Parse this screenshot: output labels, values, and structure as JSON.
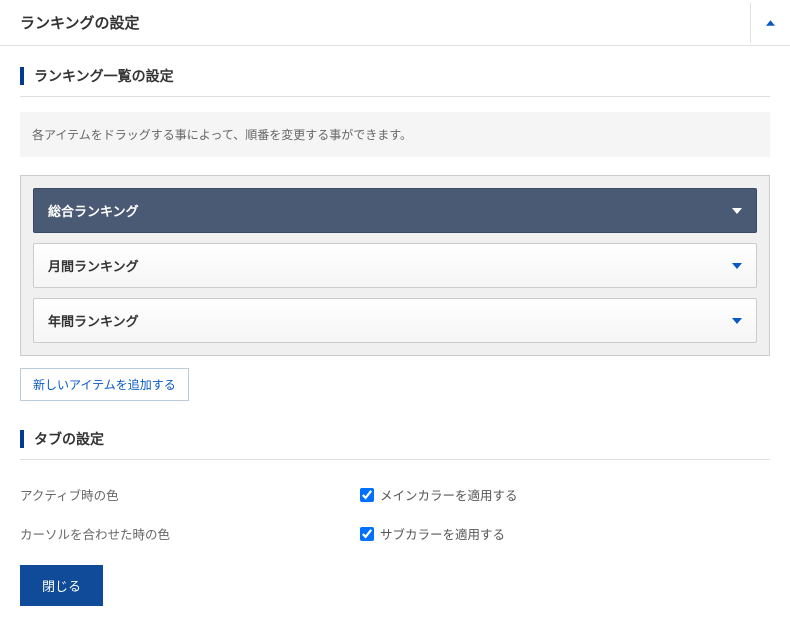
{
  "header": {
    "title": "ランキングの設定"
  },
  "section_list": {
    "title": "ランキング一覧の設定",
    "hint": "各アイテムをドラッグする事によって、順番を変更する事ができます。",
    "items": [
      {
        "label": "総合ランキング",
        "active": true
      },
      {
        "label": "月間ランキング",
        "active": false
      },
      {
        "label": "年間ランキング",
        "active": false
      }
    ],
    "add_label": "新しいアイテムを追加する"
  },
  "section_tabs": {
    "title": "タブの設定",
    "rows": [
      {
        "label": "アクティブ時の色",
        "checkbox_label": "メインカラーを適用する",
        "checked": true
      },
      {
        "label": "カーソルを合わせた時の色",
        "checkbox_label": "サブカラーを適用する",
        "checked": true
      }
    ]
  },
  "close_label": "閉じる",
  "colors": {
    "accent": "#003b8e",
    "caret_active": "#ffffff",
    "caret_inactive": "#0859c5"
  }
}
